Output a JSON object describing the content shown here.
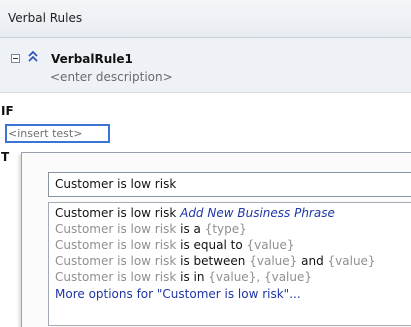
{
  "panel": {
    "title": "Verbal Rules"
  },
  "rule": {
    "name": "VerbalRule1",
    "description_placeholder": "<enter description>"
  },
  "if_section": {
    "label": "IF",
    "insert_test_label": "<insert test>"
  },
  "then_section": {
    "label": "T"
  },
  "dropdown": {
    "input_value": "Customer is low risk",
    "items": [
      {
        "subject": "Customer is low risk",
        "action": "Add New Business Phrase"
      },
      {
        "subject": "Customer is low risk",
        "op": "is a",
        "arg1": "{type}"
      },
      {
        "subject": "Customer is low risk",
        "op": "is equal to",
        "arg1": "{value}"
      },
      {
        "subject": "Customer is low risk",
        "op": "is between",
        "arg1": "{value}",
        "conj": "and",
        "arg2": "{value}"
      },
      {
        "subject": "Customer is low risk",
        "op": "is in",
        "arg1": "{value}, {value}"
      },
      {
        "more": "More options for \"Customer is low risk\"..."
      }
    ]
  },
  "colors": {
    "accent": "#3c74d6",
    "link": "#1f36a6",
    "muted_text": "#8f8f8f"
  }
}
